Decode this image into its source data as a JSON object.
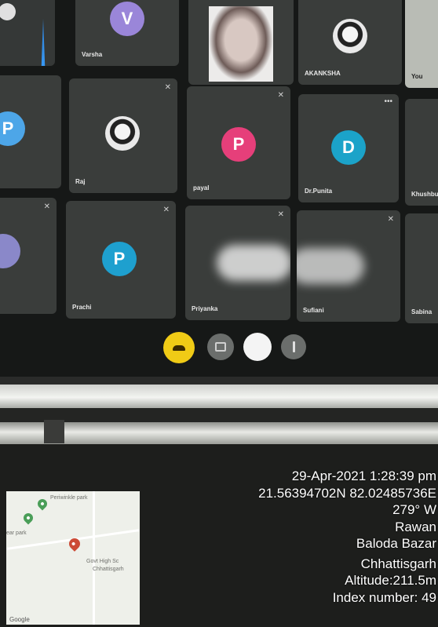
{
  "meeting": {
    "tiles": [
      {
        "name": "Varsha",
        "initial": "V",
        "color": "#9a86d9"
      },
      {
        "name": "",
        "initial": "",
        "color": ""
      },
      {
        "name": "AKANKSHA",
        "initial": "",
        "color": ""
      },
      {
        "name": "You",
        "initial": "",
        "color": ""
      },
      {
        "name": "",
        "initial": "P",
        "color": "#4da6e8"
      },
      {
        "name": "Raj",
        "initial": "",
        "color": ""
      },
      {
        "name": "payal",
        "initial": "P",
        "color": "#e63f7a"
      },
      {
        "name": "Dr.Punita",
        "initial": "D",
        "color": "#1ba3c9"
      },
      {
        "name": "Khushbu",
        "initial": "",
        "color": ""
      },
      {
        "name": "",
        "initial": "",
        "color": "#8a88c9"
      },
      {
        "name": "Prachi",
        "initial": "P",
        "color": "#1ea0cf"
      },
      {
        "name": "Priyanka",
        "initial": "",
        "color": ""
      },
      {
        "name": "Sufiani",
        "initial": "",
        "color": ""
      },
      {
        "name": "Sabina",
        "initial": "",
        "color": ""
      }
    ],
    "controls": [
      {
        "name": "end-call",
        "icon": "phone-icon",
        "color": "#f0cb16"
      },
      {
        "name": "camera",
        "icon": "camera-icon",
        "color": "#6b6e6c"
      },
      {
        "name": "share",
        "icon": "circle-icon",
        "color": "#f4f4f4"
      },
      {
        "name": "more",
        "icon": "more-icon",
        "color": "#6b6e6c"
      }
    ]
  },
  "map": {
    "place1": "Periwinkle park",
    "place2": "ear park",
    "place3": "Govt High Sc",
    "place4": "Chhattisgarh",
    "logo": "Google"
  },
  "stamp": {
    "datetime": "29-Apr-2021 1:28:39 pm",
    "coords": "21.56394702N 82.02485736E",
    "heading": "279° W",
    "village": "Rawan",
    "district": "Baloda Bazar",
    "state": "Chhattisgarh",
    "altitude": "Altitude:211.5m",
    "index": "Index number: 49"
  }
}
